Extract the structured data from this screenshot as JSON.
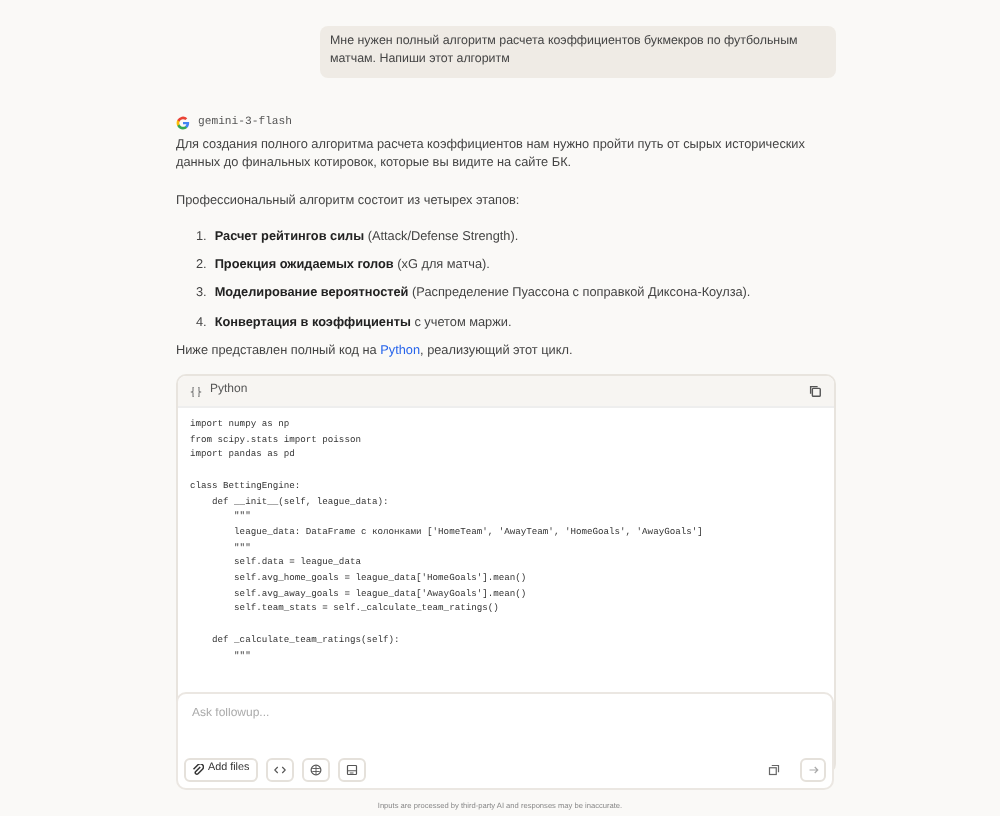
{
  "user_message": "Мне нужен полный алгоритм расчета коэффициентов букмекров по футбольным матчам. Напиши этот алгоритм",
  "model": {
    "name": "gemini-3-flash"
  },
  "intro": "Для создания полного алгоритма расчета коэффициентов нам нужно пройти путь от сырых исторических данных до финальных котировок, которые вы видите на сайте БК.",
  "lead": "Профессиональный алгоритм состоит из четырех этапов:",
  "steps": [
    {
      "number": "1.",
      "text": "**Расчет рейтингов силы** (Attack/Defense Strength)."
    },
    {
      "number": "2.",
      "text": "**Проекция ожидаемых голов** (xG для матча)."
    },
    {
      "number": "3.",
      "text": "**Моделирование вероятностей** (Распределение Пуассона с поправкой Диксона-Коулза)."
    },
    {
      "number": "4.",
      "text": "**Конвертация в коэффициенты** с учетом маржи."
    }
  ],
  "outro_parts": [
    {
      "kind": "plain",
      "text": "Ниже представлен полный код на "
    },
    {
      "kind": "link",
      "text": "Python"
    },
    {
      "kind": "plain",
      "text": ", реализующий этот цикл."
    }
  ],
  "code_block": {
    "language": "Python",
    "paragraphs": [
      [
        "import numpy as np",
        "from scipy.stats import poisson",
        "import pandas as pd"
      ],
      [
        "class BettingEngine:",
        "    def __init__(self, league_data):",
        "        \"\"\"",
        "        league_data: DataFrame с колонками ['HomeTeam', 'AwayTeam', 'HomeGoals', 'AwayGoals']",
        "        \"\"\"",
        "        self.data = league_data",
        "        self.avg_home_goals = league_data['HomeGoals'].mean()",
        "        self.avg_away_goals = league_data['AwayGoals'].mean()",
        "        self.team_stats = self._calculate_team_ratings()"
      ],
      [
        "    def _calculate_team_ratings(self):",
        "        \"\"\""
      ]
    ]
  },
  "composer": {
    "placeholder": "Ask followup...",
    "add_files": "Add files"
  },
  "footer": "Inputs are processed by third-party AI and responses may be inaccurate."
}
